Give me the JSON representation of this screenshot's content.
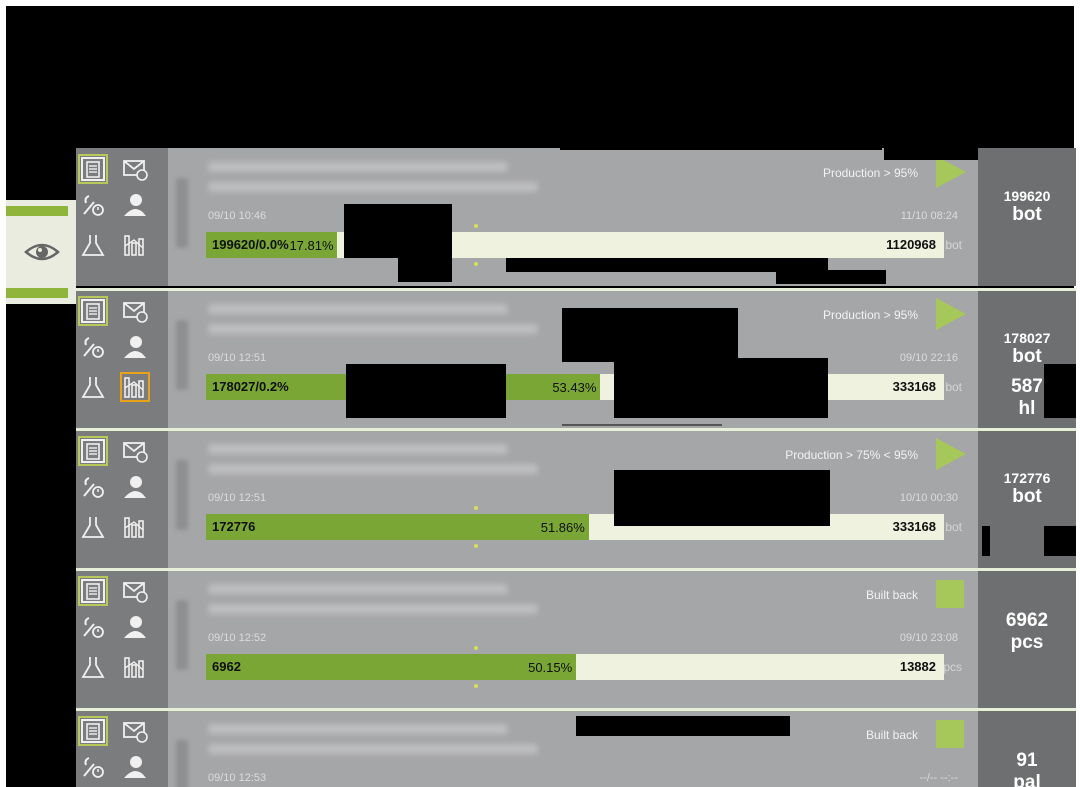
{
  "rows": [
    {
      "start": "09/10 10:46",
      "end": "11/10 08:24",
      "status": "Production > 95%",
      "indicator": "play",
      "bar_left": "199620/0.0%",
      "percent": "17.81%",
      "progress": 0.1781,
      "total": "1120968",
      "unit": "bot",
      "side_value": "199620",
      "side_unit": "bot"
    },
    {
      "start": "09/10 12:51",
      "end": "09/10 22:16",
      "status": "Production > 95%",
      "indicator": "play",
      "bar_left": "178027/0.2%",
      "percent": "53.43%",
      "progress": 0.5343,
      "total": "333168",
      "unit": "bot",
      "side_value": "178027",
      "side_unit": "bot",
      "side_value2": "587",
      "side_unit2": "hl"
    },
    {
      "start": "09/10 12:51",
      "end": "10/10 00:30",
      "status": "Production > 75% < 95%",
      "indicator": "play",
      "bar_left": "172776",
      "percent": "51.86%",
      "progress": 0.5186,
      "total": "333168",
      "unit": "bot",
      "side_value": "172776",
      "side_unit": "bot"
    },
    {
      "start": "09/10 12:52",
      "end": "09/10 23:08",
      "status": "Built back",
      "indicator": "square",
      "bar_left": "6962",
      "percent": "50.15%",
      "progress": 0.5015,
      "total": "13882",
      "unit": "pcs",
      "side_value": "6962",
      "side_unit": "pcs"
    },
    {
      "start": "09/10 12:53",
      "end": "--/-- --:--",
      "status": "Built back",
      "indicator": "square",
      "side_value": "91",
      "side_unit": "pal"
    }
  ],
  "icons": [
    "report-icon",
    "mail-icon",
    "tools-icon",
    "user-icon",
    "flask-icon",
    "chart-icon",
    "eye-icon"
  ],
  "colors": {
    "accent_green": "#79a634",
    "indicator_green": "#a6c75a",
    "selected_orange": "#e8a21a",
    "bar_background": "#eff2df"
  }
}
